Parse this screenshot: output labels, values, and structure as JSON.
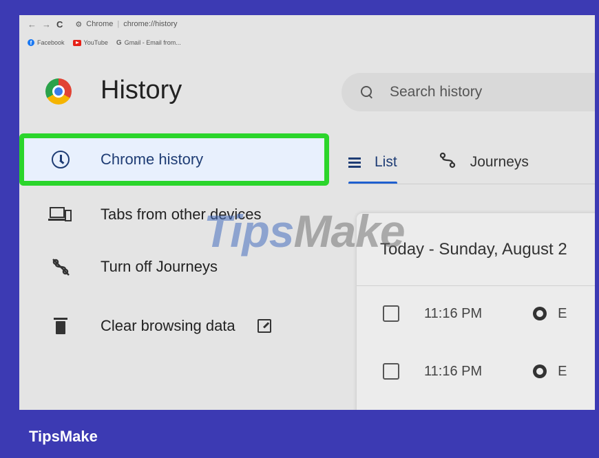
{
  "browser": {
    "back": "←",
    "forward": "→",
    "reload": "C",
    "url_site": "Chrome",
    "url_sep": "|",
    "url_path": "chrome://history",
    "bookmarks": [
      {
        "label": "Facebook",
        "icon": "facebook-icon"
      },
      {
        "label": "YouTube",
        "icon": "youtube-icon"
      },
      {
        "label": "Gmail - Email from...",
        "icon": "google-icon"
      }
    ]
  },
  "header": {
    "title": "History",
    "search_placeholder": "Search history"
  },
  "sidebar": {
    "items": [
      {
        "label": "Chrome history",
        "icon": "clock-icon",
        "active": true
      },
      {
        "label": "Tabs from other devices",
        "icon": "devices-icon"
      },
      {
        "label": "Turn off Journeys",
        "icon": "journeys-off-icon"
      },
      {
        "label": "Clear browsing data",
        "icon": "trash-icon"
      }
    ]
  },
  "tabs": [
    {
      "label": "List",
      "icon": "list-icon",
      "selected": true
    },
    {
      "label": "Journeys",
      "icon": "journeys-icon"
    }
  ],
  "history": {
    "date_header": "Today - Sunday, August 2",
    "entries": [
      {
        "time": "11:16 PM",
        "site": "E"
      },
      {
        "time": "11:16 PM",
        "site": "E"
      }
    ]
  },
  "watermark": {
    "part1": "Tips",
    "part2": "Make"
  },
  "brand": "TipsMake",
  "colors": {
    "frame": "#3c3ab3",
    "highlight": "#2bd52b",
    "accent": "#1e5fcf"
  }
}
